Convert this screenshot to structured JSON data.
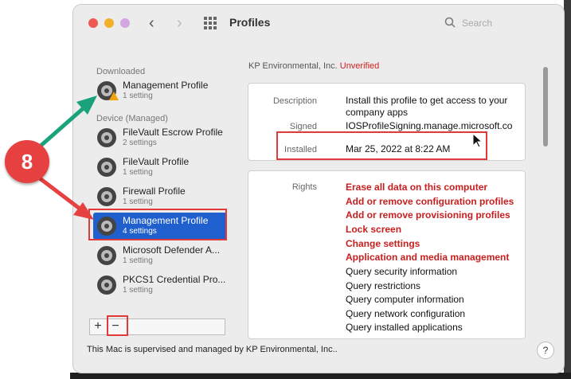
{
  "window": {
    "title": "Profiles",
    "search_placeholder": "Search"
  },
  "sidebar": {
    "downloaded_label": "Downloaded",
    "managed_label": "Device (Managed)",
    "downloaded": [
      {
        "name": "Management Profile",
        "sub": "1 setting"
      }
    ],
    "managed": [
      {
        "name": "FileVault Escrow Profile",
        "sub": "2 settings"
      },
      {
        "name": "FileVault Profile",
        "sub": "1 setting"
      },
      {
        "name": "Firewall Profile",
        "sub": "1 setting"
      },
      {
        "name": "Management Profile",
        "sub": "4 settings"
      },
      {
        "name": "Microsoft Defender A...",
        "sub": "1 setting"
      },
      {
        "name": "PKCS1 Credential Pro...",
        "sub": "1 setting"
      }
    ],
    "add_label": "+",
    "remove_label": "−"
  },
  "detail": {
    "organization": "KP Environmental, Inc.",
    "status": "Unverified",
    "description_label": "Description",
    "description": "Install this profile to get access to your company apps",
    "signed_label": "Signed",
    "signed": "IOSProfileSigning.manage.microsoft.co m",
    "installed_label": "Installed",
    "installed": "Mar 25, 2022 at 8:22 AM",
    "rights_label": "Rights",
    "rights_bold": [
      "Erase all data on this computer",
      "Add or remove configuration profiles",
      "Add or remove provisioning profiles",
      "Lock screen",
      "Change settings",
      "Application and media management"
    ],
    "rights": [
      "Query security information",
      "Query restrictions",
      "Query computer information",
      "Query network configuration",
      "Query installed applications"
    ]
  },
  "footer": {
    "text": "This Mac is supervised and managed by KP Environmental, Inc..",
    "help": "?"
  },
  "annotation": {
    "step": "8",
    "color": "#e64040",
    "arrow_colors": [
      "#1aa37a",
      "#e64040"
    ]
  }
}
